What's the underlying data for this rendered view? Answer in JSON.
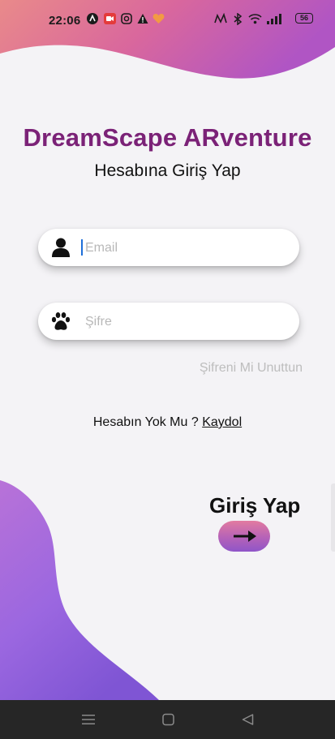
{
  "status_bar": {
    "time": "22:06",
    "notification_icons": [
      "a-icon",
      "video-icon",
      "instagram-icon",
      "warning-icon",
      "heart-icon"
    ],
    "system_icons": [
      "nfc-icon",
      "bluetooth-icon",
      "wifi-icon",
      "signal-icon"
    ],
    "battery": "56"
  },
  "app": {
    "title": "DreamScape ARventure",
    "subtitle": "Hesabına Giriş Yap"
  },
  "form": {
    "email_placeholder": "Email",
    "email_value": "",
    "password_placeholder": "Şifre",
    "password_value": "",
    "forgot_label": "Şifreni Mi Unuttun",
    "no_account_text": "Hesabın Yok Mu ?",
    "signup_link": "Kaydol",
    "login_label": "Giriş Yap"
  },
  "nav_bar": {
    "icons": [
      "menu-icon",
      "home-square-icon",
      "back-triangle-icon"
    ]
  },
  "colors": {
    "title": "#7b2277",
    "gradient_pink": "#e8799a",
    "gradient_purple": "#8b5cd6",
    "background": "#f4f3f6"
  }
}
